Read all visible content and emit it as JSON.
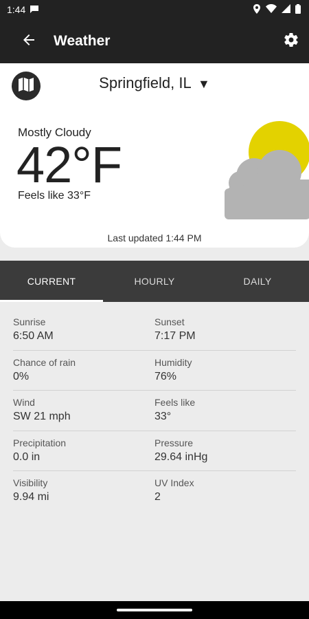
{
  "status_bar": {
    "time": "1:44"
  },
  "app_bar": {
    "title": "Weather"
  },
  "current": {
    "location": "Springfield, IL",
    "dropdown_glyph": "▼",
    "condition": "Mostly Cloudy",
    "temperature": "42°F",
    "feels_like": "Feels like 33°F",
    "last_updated": "Last updated 1:44 PM"
  },
  "tabs": [
    {
      "label": "CURRENT",
      "active": true
    },
    {
      "label": "HOURLY",
      "active": false
    },
    {
      "label": "DAILY",
      "active": false
    }
  ],
  "details": [
    [
      {
        "label": "Sunrise",
        "value": "6:50 AM"
      },
      {
        "label": "Sunset",
        "value": "7:17 PM"
      }
    ],
    [
      {
        "label": "Chance of rain",
        "value": "0%"
      },
      {
        "label": "Humidity",
        "value": "76%"
      }
    ],
    [
      {
        "label": "Wind",
        "value": "SW 21 mph"
      },
      {
        "label": "Feels like",
        "value": "33°"
      }
    ],
    [
      {
        "label": "Precipitation",
        "value": "0.0 in"
      },
      {
        "label": "Pressure",
        "value": "29.64 inHg"
      }
    ],
    [
      {
        "label": "Visibility",
        "value": "9.94 mi"
      },
      {
        "label": "UV Index",
        "value": "2"
      }
    ]
  ],
  "icons": {
    "back": "arrow-left-icon",
    "settings": "gear-icon",
    "map": "map-icon",
    "weather": "partly-cloudy-icon"
  },
  "colors": {
    "app_bar": "#222222",
    "tab_bar": "#3b3b3b",
    "background": "#ececec",
    "sun": "#e3d200",
    "cloud": "#b3b3b3"
  }
}
